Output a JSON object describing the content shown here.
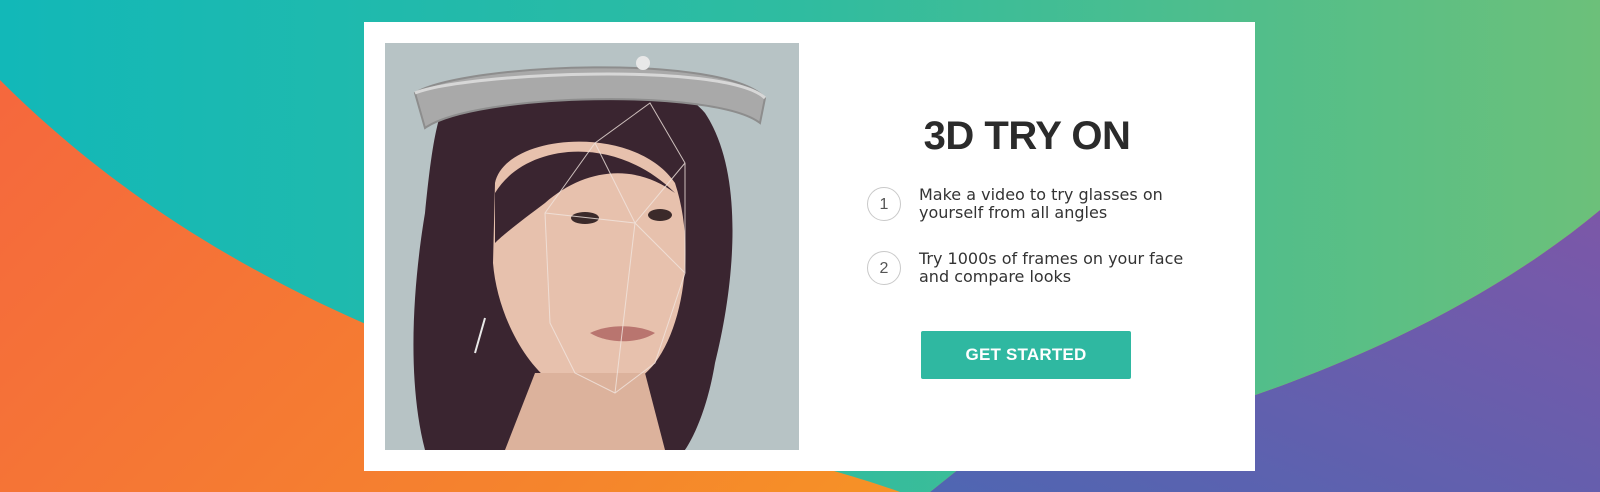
{
  "colors": {
    "accent_teal": "#2fb8a1",
    "background_orange": "#f5713c",
    "background_purple": "#6b57a8",
    "background_teal": "#14b8b0",
    "background_green": "#5dbf7f"
  },
  "hero": {
    "image_alt": "Woman with 3D face-scan overlay",
    "title": "3D TRY ON",
    "steps": [
      {
        "number": "1",
        "text": "Make a video to try glasses on yourself from all angles"
      },
      {
        "number": "2",
        "text": "Try 1000s of frames on your face and compare looks"
      }
    ],
    "cta_label": "GET STARTED"
  }
}
